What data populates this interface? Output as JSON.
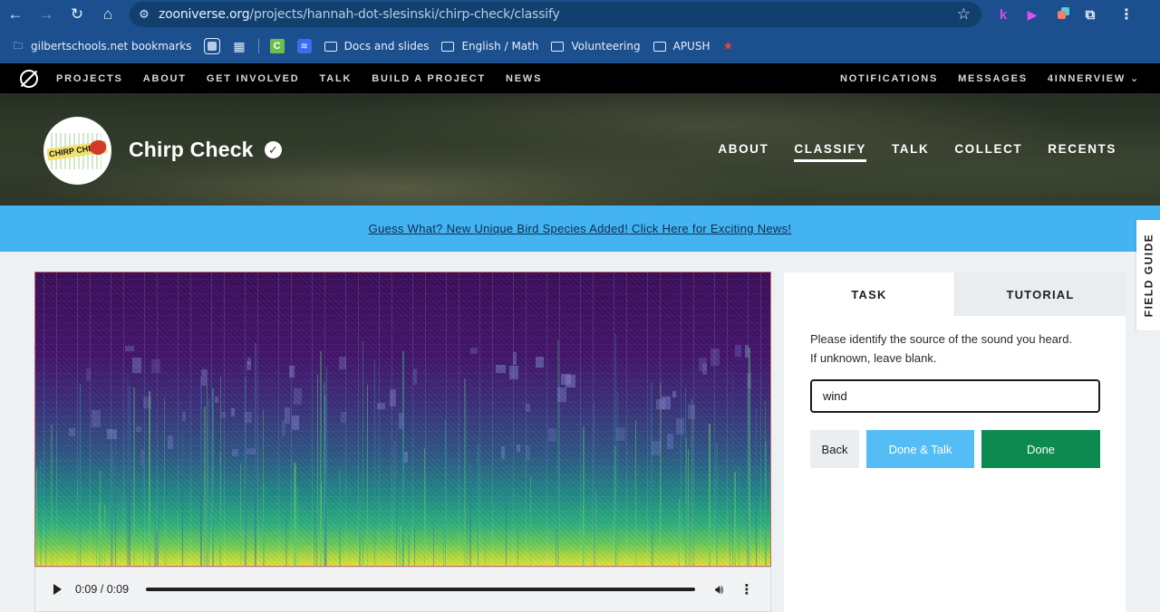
{
  "browser": {
    "url_host": "zooniverse.org",
    "url_path": "/projects/hannah-dot-slesinski/chirp-check/classify",
    "extensions": [
      "k-extension-icon",
      "film-extension-icon",
      "recorder-extension-icon",
      "puzzle-icon"
    ]
  },
  "bookmarks": {
    "items": [
      {
        "label": "gilbertschools.net bookmarks",
        "icon": "managed-bookmarks-icon"
      },
      {
        "label": "Docs and slides",
        "icon": "folder-icon"
      },
      {
        "label": "English / Math",
        "icon": "folder-icon"
      },
      {
        "label": "Volunteering",
        "icon": "folder-icon"
      },
      {
        "label": "APUSH",
        "icon": "folder-icon"
      }
    ]
  },
  "zoo_nav": {
    "left": [
      "PROJECTS",
      "ABOUT",
      "GET INVOLVED",
      "TALK",
      "BUILD A PROJECT",
      "NEWS"
    ],
    "right": [
      "NOTIFICATIONS",
      "MESSAGES",
      "4INNERVIEW"
    ]
  },
  "project": {
    "logo_text": "CHIRP CHECK",
    "title": "Chirp Check",
    "nav": [
      "ABOUT",
      "CLASSIFY",
      "TALK",
      "COLLECT",
      "RECENTS"
    ],
    "active_nav": "CLASSIFY"
  },
  "announcement": {
    "text": "Guess What? New Unique Bird Species Added! Click Here for Exciting News!"
  },
  "audio": {
    "time": "0:09 / 0:09",
    "progress": 1.0
  },
  "task": {
    "tabs": [
      "TASK",
      "TUTORIAL"
    ],
    "active_tab": "TASK",
    "question_line1": "Please identify the source of the sound you heard.",
    "question_line2": "If unknown, leave blank.",
    "answer_value": "wind",
    "buttons": {
      "back": "Back",
      "done_talk": "Done & Talk",
      "done": "Done"
    }
  },
  "field_guide": {
    "label": "FIELD GUIDE"
  },
  "colors": {
    "browser_blue": "#1b4f8e",
    "announcement_blue": "#43b4f1",
    "done_green": "#0c8a4f",
    "done_talk_blue": "#54bdf6"
  }
}
